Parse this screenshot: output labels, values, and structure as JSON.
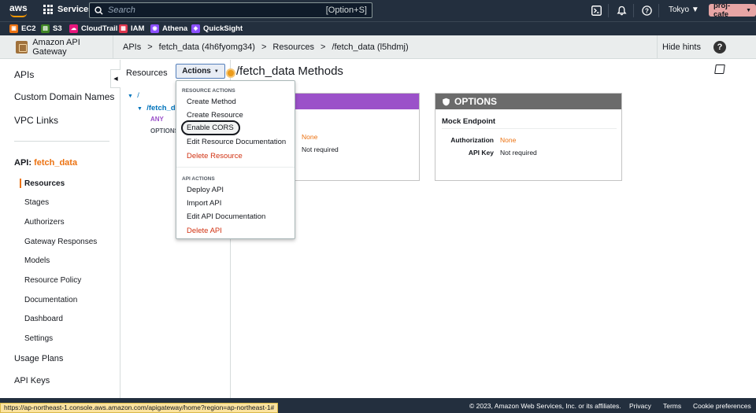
{
  "topbar": {
    "logo_text": "aws",
    "services_label": "Services",
    "search_placeholder": "Search",
    "search_shortcut": "[Option+S]",
    "region": "Tokyo",
    "account": "proj-cafe"
  },
  "favorites": [
    {
      "label": "EC2",
      "color": "#ec7211"
    },
    {
      "label": "S3",
      "color": "#3f8624"
    },
    {
      "label": "CloudTrail",
      "color": "#e7157b"
    },
    {
      "label": "IAM",
      "color": "#dd344c"
    },
    {
      "label": "Athena",
      "color": "#8c4fff"
    },
    {
      "label": "QuickSight",
      "color": "#8c4fff"
    }
  ],
  "header": {
    "app_name": "Amazon API Gateway",
    "breadcrumbs": [
      "APIs",
      ">",
      "fetch_data (4h6fyomg34)",
      ">",
      "Resources",
      ">",
      "/fetch_data (l5hdmj)"
    ],
    "hide_hints": "Hide hints",
    "help_glyph": "?"
  },
  "sidebar": {
    "top_items": [
      "APIs",
      "Custom Domain Names",
      "VPC Links"
    ],
    "api_prefix": "API:",
    "api_name": "fetch_data",
    "sub_items": [
      "Resources",
      "Stages",
      "Authorizers",
      "Gateway Responses",
      "Models",
      "Resource Policy",
      "Documentation",
      "Dashboard",
      "Settings"
    ],
    "bottom_items": [
      "Usage Plans",
      "API Keys"
    ]
  },
  "resources": {
    "title": "Resources",
    "root": "/",
    "child": "/fetch_d",
    "methods": [
      "ANY",
      "OPTIONS"
    ]
  },
  "actions": {
    "label": "Actions",
    "resource_section": "RESOURCE ACTIONS",
    "resource_items": [
      "Create Method",
      "Create Resource",
      "Enable CORS",
      "Edit Resource Documentation",
      "Delete Resource"
    ],
    "api_section": "API ACTIONS",
    "api_items": [
      "Deploy API",
      "Import API",
      "Edit API Documentation",
      "Delete API"
    ]
  },
  "page_title": "/fetch_data Methods",
  "any_card": {
    "authorization": "None",
    "api_key": "Not required",
    "color": "#9b51c9"
  },
  "options_card": {
    "title": "OPTIONS",
    "subtitle": "Mock Endpoint",
    "authorization_label": "Authorization",
    "authorization": "None",
    "api_key_label": "API Key",
    "api_key": "Not required",
    "color": "#6b6b6b"
  },
  "footer": {
    "copyright": "© 2023, Amazon Web Services, Inc. or its affiliates.",
    "links": [
      "Privacy",
      "Terms",
      "Cookie preferences"
    ],
    "status_url": "https://ap-northeast-1.console.aws.amazon.com/apigateway/home?region=ap-northeast-1#"
  },
  "colors": {
    "accent": "#ec7211",
    "link": "#0073bb",
    "nav_bg": "#232f3e",
    "danger": "#d13212"
  }
}
